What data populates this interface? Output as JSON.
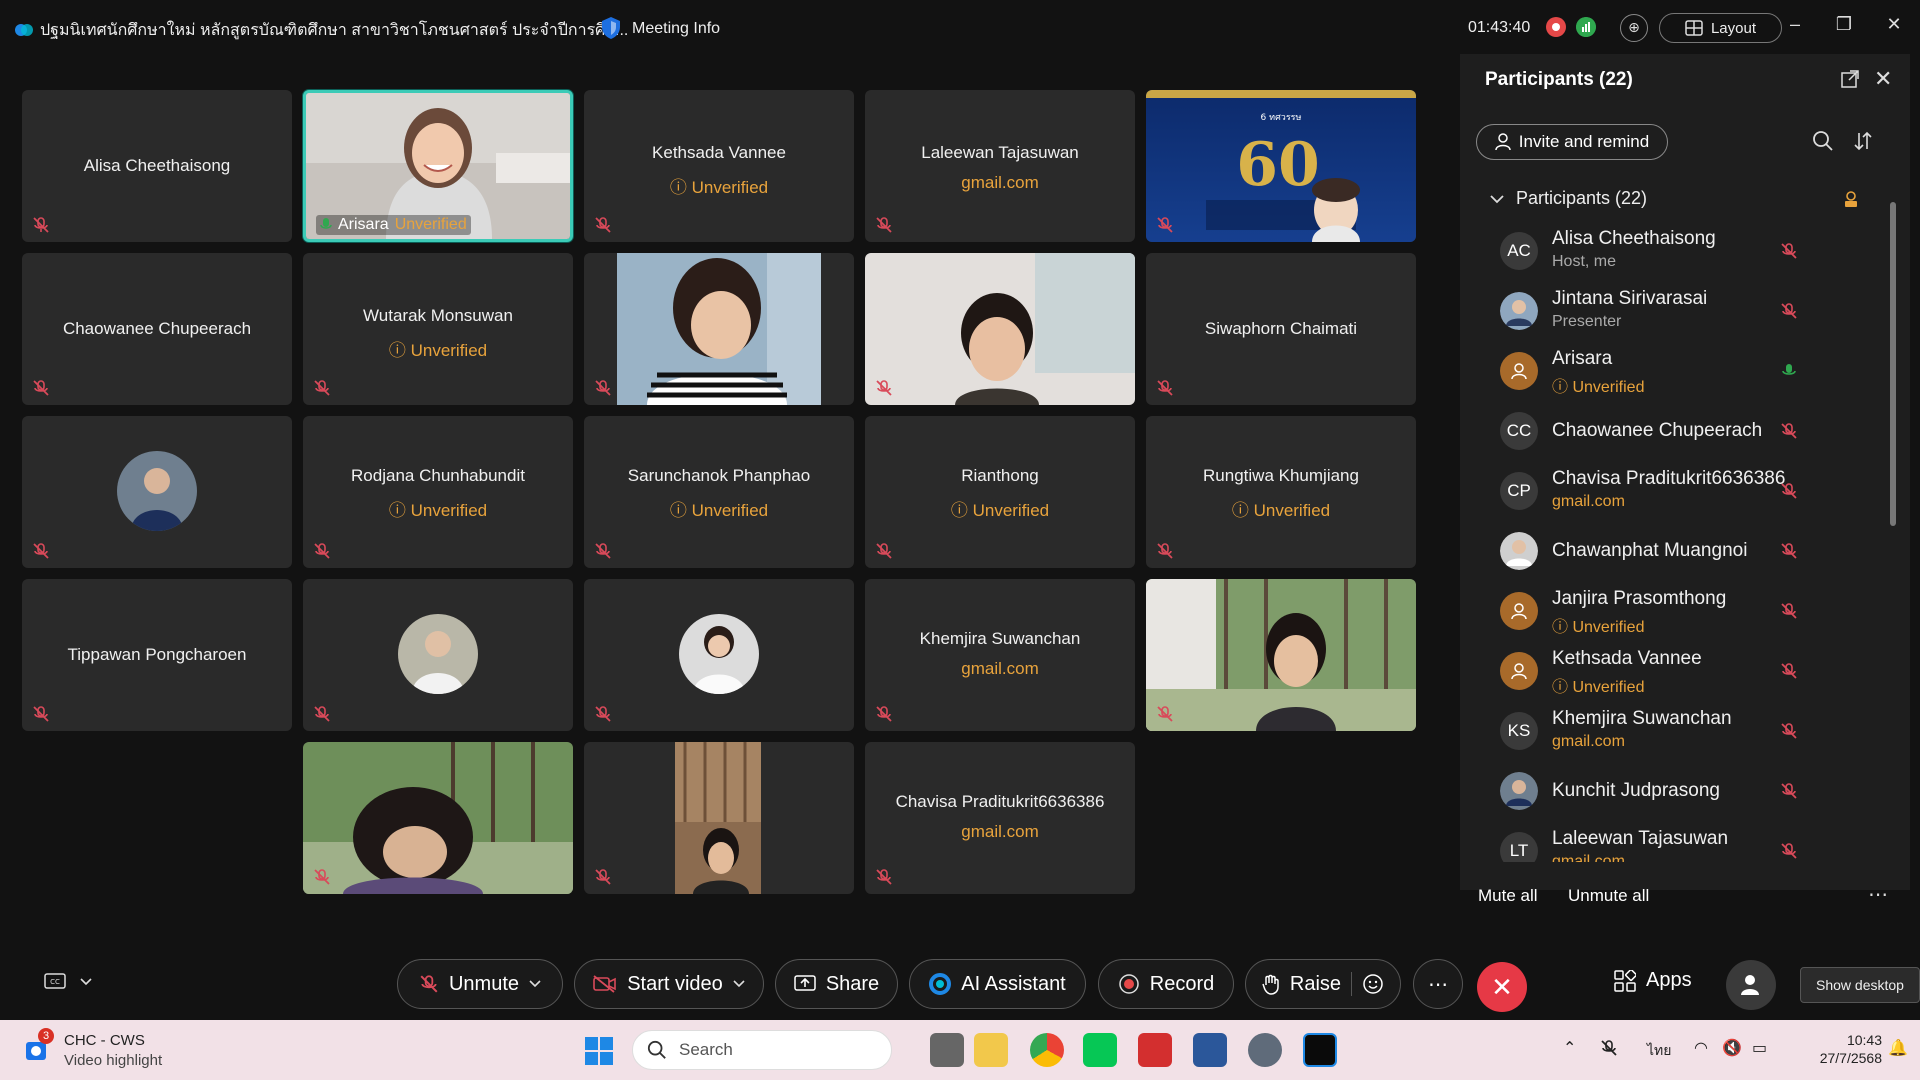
{
  "window": {
    "title": "ปฐมนิเทศนักศึกษาใหม่ หลักสูตรบัณฑิตศึกษา สาขาวิชาโภชนศาสตร์ ประจำปีการศึก...",
    "meeting_info": "Meeting Info",
    "timer": "01:43:40",
    "layout_label": "Layout"
  },
  "tiles": [
    {
      "name": "Alisa Cheethaisong",
      "sub": ""
    },
    {
      "name": "Arisara",
      "sub": "Unverified"
    },
    {
      "name": "Kethsada Vannee",
      "sub": "Unverified"
    },
    {
      "name": "Laleewan Tajasuwan",
      "sub": "gmail.com"
    },
    {
      "name": "Chaowanee Chupeerach",
      "sub": ""
    },
    {
      "name": "Wutarak Monsuwan",
      "sub": "Unverified"
    },
    {
      "name": "Siwaphorn Chaimati",
      "sub": ""
    },
    {
      "name": "Rodjana Chunhabundit",
      "sub": "Unverified"
    },
    {
      "name": "Sarunchanok Phanphao",
      "sub": "Unverified"
    },
    {
      "name": "Rianthong",
      "sub": "Unverified"
    },
    {
      "name": "Rungtiwa Khumjiang",
      "sub": "Unverified"
    },
    {
      "name": "Tippawan Pongcharoen",
      "sub": ""
    },
    {
      "name": "Khemjira  Suwanchan",
      "sub": "gmail.com"
    },
    {
      "name": "Chavisa Praditukrit6636386",
      "sub": "gmail.com"
    }
  ],
  "panel": {
    "title": "Participants (22)",
    "invite_label": "Invite and remind",
    "group_label": "Participants (22)",
    "mute_all": "Mute all",
    "unmute_all": "Unmute all",
    "participants": [
      {
        "initials": "AC",
        "name": "Alisa Cheethaisong",
        "role": "Host, me"
      },
      {
        "initials": "",
        "name": "Jintana Sirivarasai",
        "role": "Presenter"
      },
      {
        "initials": "",
        "name": "Arisara",
        "role": "Unverified"
      },
      {
        "initials": "CC",
        "name": "Chaowanee Chupeerach",
        "role": ""
      },
      {
        "initials": "CP",
        "name": "Chavisa Praditukrit6636386",
        "role": "gmail.com"
      },
      {
        "initials": "",
        "name": "Chawanphat Muangnoi",
        "role": ""
      },
      {
        "initials": "",
        "name": "Janjira Prasomthong",
        "role": "Unverified"
      },
      {
        "initials": "",
        "name": "Kethsada Vannee",
        "role": "Unverified"
      },
      {
        "initials": "KS",
        "name": "Khemjira  Suwanchan",
        "role": "gmail.com"
      },
      {
        "initials": "",
        "name": "Kunchit Judprasong",
        "role": ""
      },
      {
        "initials": "LT",
        "name": "Laleewan Tajasuwan",
        "role": "gmail.com"
      }
    ]
  },
  "controls": {
    "unmute": "Unmute",
    "start_video": "Start video",
    "share": "Share",
    "ai_assistant": "AI Assistant",
    "record": "Record",
    "raise": "Raise",
    "apps": "Apps",
    "show_desktop": "Show desktop"
  },
  "taskbar": {
    "notify_count": "3",
    "app_name": "CHC - CWS",
    "app_sub": "Video highlight",
    "search": "Search",
    "lang": "ไทย",
    "time": "10:43",
    "date": "27/7/2568"
  },
  "colors": {
    "accent": "#3ccbb7",
    "warning": "#e8a33c",
    "end_call": "#e63946",
    "mute_red": "#d94a5a",
    "unmuted_green": "#2fa84f"
  }
}
